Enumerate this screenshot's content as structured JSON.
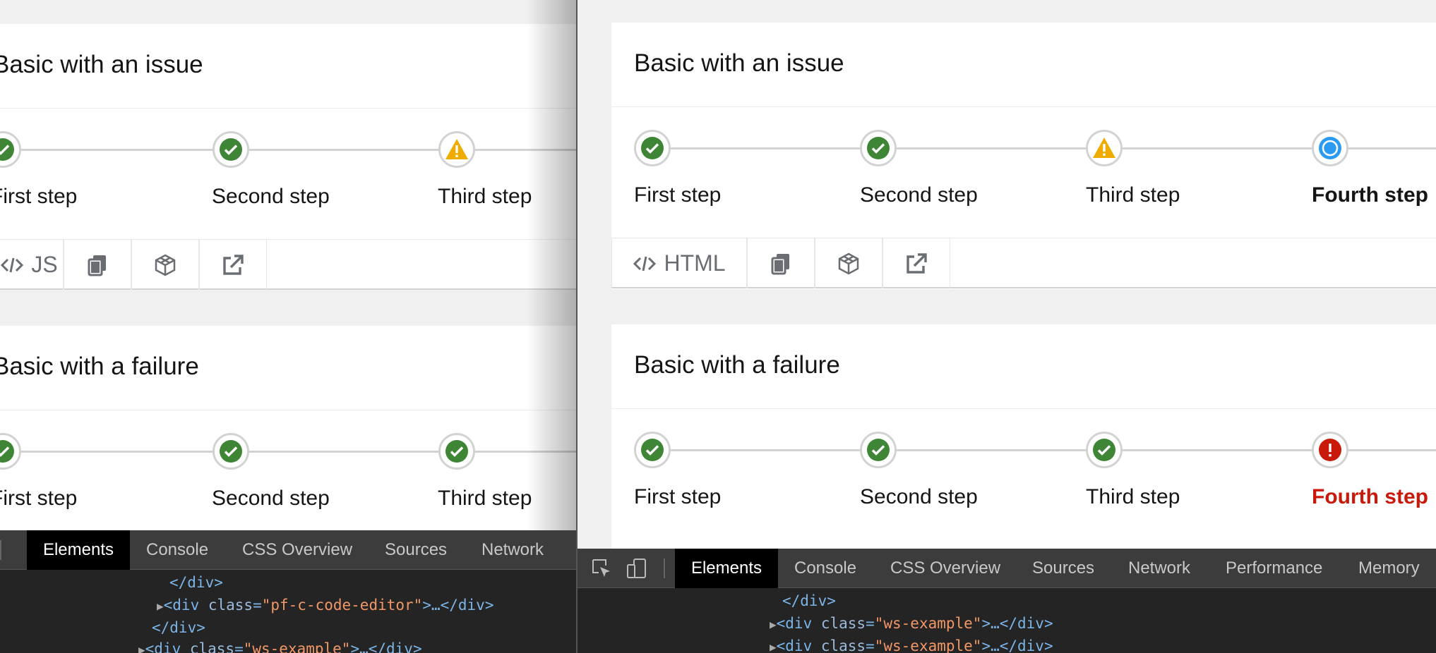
{
  "left": {
    "sections": [
      {
        "title": "Basic with an issue",
        "steps": [
          {
            "label": "First step",
            "status": "success"
          },
          {
            "label": "Second step",
            "status": "success"
          },
          {
            "label": "Third step",
            "status": "warning"
          }
        ],
        "toolbar": {
          "lang_label": "JS",
          "buttons": [
            "code-icon",
            "copy-icon",
            "codesandbox-icon",
            "external-link-icon"
          ]
        }
      },
      {
        "title": "Basic with a failure",
        "steps": [
          {
            "label": "First step",
            "status": "success"
          },
          {
            "label": "Second step",
            "status": "success"
          },
          {
            "label": "Third step",
            "status": "success"
          }
        ]
      }
    ],
    "devtools": {
      "tabs": [
        "Elements",
        "Console",
        "CSS Overview",
        "Sources",
        "Network"
      ],
      "active_tab": "Elements",
      "code": [
        {
          "open": "</div>"
        },
        {
          "open": "<div ",
          "attr": "class",
          "val": "\"pf-c-code-editor\"",
          "close": ">…</div>"
        },
        {
          "open": "</div>"
        },
        {
          "open": "<div ",
          "attr": "class",
          "val": "\"ws-example\"",
          "close": ">…</div>"
        }
      ]
    }
  },
  "right": {
    "sections": [
      {
        "title": "Basic with an issue",
        "steps": [
          {
            "label": "First step",
            "status": "success"
          },
          {
            "label": "Second step",
            "status": "success"
          },
          {
            "label": "Third step",
            "status": "warning"
          },
          {
            "label": "Fourth step",
            "status": "current"
          }
        ],
        "toolbar": {
          "lang_label": "HTML",
          "buttons": [
            "code-icon",
            "copy-icon",
            "codesandbox-icon",
            "external-link-icon"
          ]
        }
      },
      {
        "title": "Basic with a failure",
        "steps": [
          {
            "label": "First step",
            "status": "success"
          },
          {
            "label": "Second step",
            "status": "success"
          },
          {
            "label": "Third step",
            "status": "success"
          },
          {
            "label": "Fourth step",
            "status": "danger"
          }
        ]
      }
    ],
    "devtools": {
      "tabs": [
        "Elements",
        "Console",
        "CSS Overview",
        "Sources",
        "Network",
        "Performance",
        "Memory"
      ],
      "active_tab": "Elements",
      "code": [
        {
          "open": "</div>"
        },
        {
          "open": "<div ",
          "attr": "class",
          "val": "\"ws-example\"",
          "close": ">…</div>"
        },
        {
          "open": "<div ",
          "attr": "class",
          "val": "\"ws-example\"",
          "close": ">…</div>"
        }
      ]
    }
  },
  "colors": {
    "success": "#3e8635",
    "warning": "#f0ab00",
    "current": "#2b9af3",
    "danger": "#c9190b"
  }
}
